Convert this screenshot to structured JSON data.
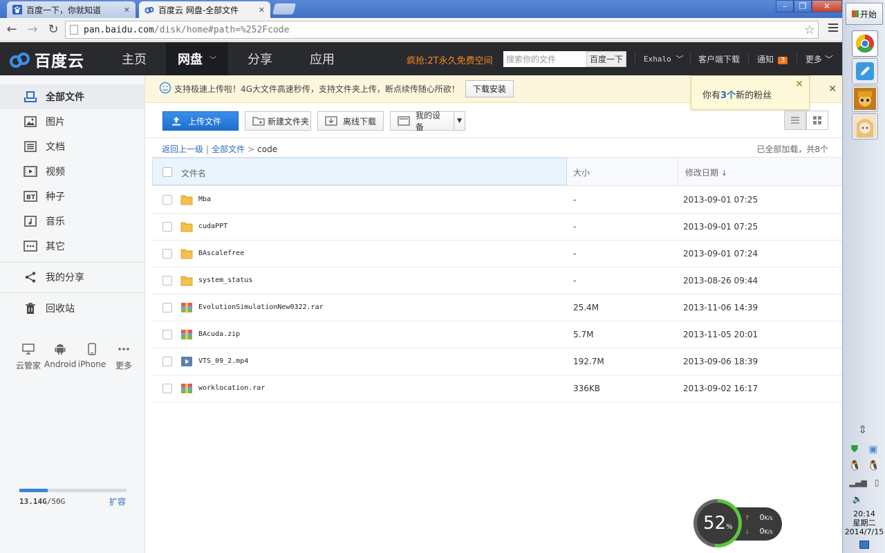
{
  "browser": {
    "tabs": [
      {
        "title": "百度一下，你就知道",
        "active": false
      },
      {
        "title": "百度云 网盘-全部文件",
        "active": true
      }
    ],
    "url_host": "pan.baidu.com",
    "url_path": "/disk/home#path=%252Fcode"
  },
  "header": {
    "logo": "百度云",
    "nav": [
      "主页",
      "网盘",
      "分享",
      "应用"
    ],
    "promo": "疯抢:2T永久免费空间",
    "search_placeholder": "搜索你的文件",
    "search_button": "百度一下",
    "user": "Exhalo",
    "client_download": "客户端下载",
    "notify": "通知",
    "notify_count": "3",
    "more": "更多"
  },
  "sidebar": {
    "items": [
      "全部文件",
      "图片",
      "文档",
      "视频",
      "种子",
      "音乐",
      "其它"
    ],
    "my_share": "我的分享",
    "recycle": "回收站",
    "devices": [
      "云管家",
      "Android",
      "iPhone",
      "更多"
    ],
    "quota_used": "13.14G",
    "quota_total": "/50G",
    "quota_fraction": 0.263,
    "expand": "扩容"
  },
  "notice": {
    "text": "支持极速上传啦！4G大文件高速秒传，支持文件夹上传，断点续传随心所欲！",
    "button": "下载安装"
  },
  "fans_popup": {
    "prefix": "你有",
    "count": "3个",
    "suffix": "新的粉丝"
  },
  "toolbar": {
    "upload": "上传文件",
    "new_folder": "新建文件夹",
    "offline": "离线下载",
    "my_devices": "我的设备"
  },
  "breadcrumb": {
    "back": "返回上一级",
    "root": "全部文件",
    "current": "code",
    "status": "已全部加载，共8个"
  },
  "table": {
    "headers": {
      "name": "文件名",
      "size": "大小",
      "date": "修改日期"
    },
    "rows": [
      {
        "name": "Mba",
        "type": "folder",
        "size": "-",
        "date": "2013-09-01 07:25"
      },
      {
        "name": "cudaPPT",
        "type": "folder",
        "size": "-",
        "date": "2013-09-01 07:25"
      },
      {
        "name": "BAscalefree",
        "type": "folder",
        "size": "-",
        "date": "2013-09-01 07:24"
      },
      {
        "name": "system_status",
        "type": "folder",
        "size": "-",
        "date": "2013-08-26 09:44"
      },
      {
        "name": "EvolutionSimulationNew0322.rar",
        "type": "archive",
        "size": "25.4M",
        "date": "2013-11-06 14:39"
      },
      {
        "name": "BAcuda.zip",
        "type": "archive",
        "size": "5.7M",
        "date": "2013-11-05 20:01"
      },
      {
        "name": "VTS_09_2.mp4",
        "type": "video",
        "size": "192.7M",
        "date": "2013-09-06 18:39"
      },
      {
        "name": "worklocation.rar",
        "type": "archive",
        "size": "336KB",
        "date": "2013-09-02 16:17"
      }
    ]
  },
  "speed_widget": {
    "percent": "52",
    "percent_unit": "%",
    "up": "0",
    "down": "0",
    "unit": "K/s"
  },
  "taskbar": {
    "start": "开始",
    "time": "20:14",
    "weekday": "星期二",
    "date": "2014/7/15"
  }
}
